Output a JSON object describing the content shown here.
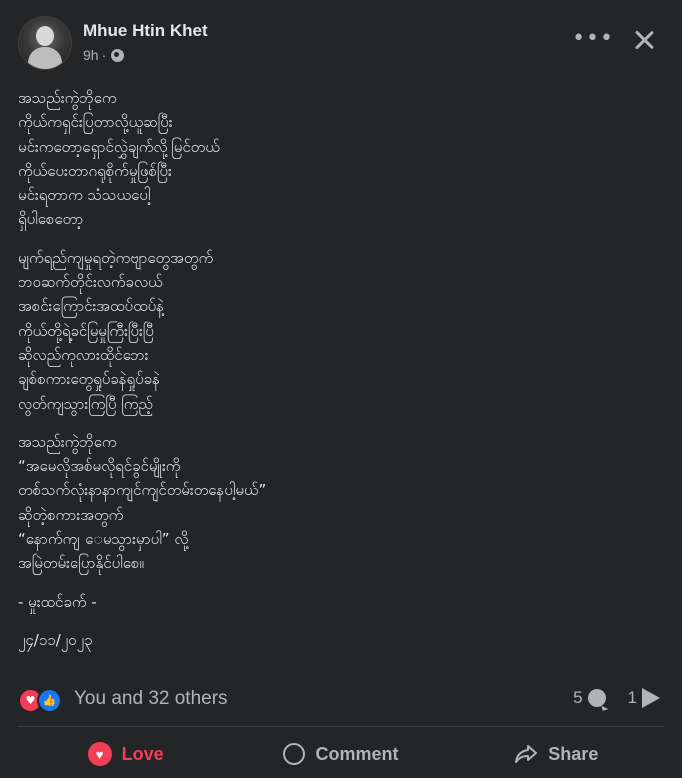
{
  "post": {
    "author": "Mhue Htin Khet",
    "time": "9h",
    "time_separator": "·",
    "more_label": "•••",
    "paragraphs": [
      "အသည်းကွဲဘိုကေ\nကိုယ်ကရှင်းပြတာလို့ယူဆပြီး\nမင်းကတော့ရှောင်လွှဲချက်လို့မြင်တယ်\nကိုယ်ပေးတာဂရုစိုက်မှုဖြစ်ပြီး\nမင်းရတာက သံသယပေါ့\nရှိပါစေတော့",
      "မျက်ရည်ကျမှုရတဲ့ကဗျာတွေအတွက်\nဘဝဆက်တိုင်းလက်ခလယ်\nအစင်းကြောင်းအထပ်ထပ်နဲ့\nကိုယ်တို့ရဲ့ခင်မြမှုကြီးပြီးပြီ\nဆိုလည်ကုလားထိုင်ဘေး\nချစ်စကားတွေရှုပ်ခနဲရှုပ်ခနဲ\nလွတ်ကျသွားကြပြီ ကြည့်",
      "အသည်းကွဲဘိုကေ\n“အမေလိုအစ်မလိုရင်ခွင်မျိုးကို\nတစ်သက်လုံးနာနာကျင်ကျင်တမ်းတနေပါ့မယ်”\nဆိုတဲ့စကားအတွက်\n“နောက်ကျ ေမသွားမှာပါ” လို့\nအမြဲတမ်းပြောနိုင်ပါစေ။",
      "- မှုးထင်ခက် -",
      "၂၄/၁၁/၂၀၂၃"
    ]
  },
  "reactions": {
    "summary": "You and 32 others",
    "love_glyph": "♥",
    "like_glyph": "👍",
    "comments_count": "5",
    "shares_count": "1"
  },
  "actions": {
    "love_label": "Love",
    "comment_label": "Comment",
    "share_label": "Share"
  },
  "colors": {
    "background": "#242526",
    "text": "#e4e6eb",
    "muted": "#b0b3b8",
    "love": "#f33e58",
    "like": "#1877f2"
  }
}
